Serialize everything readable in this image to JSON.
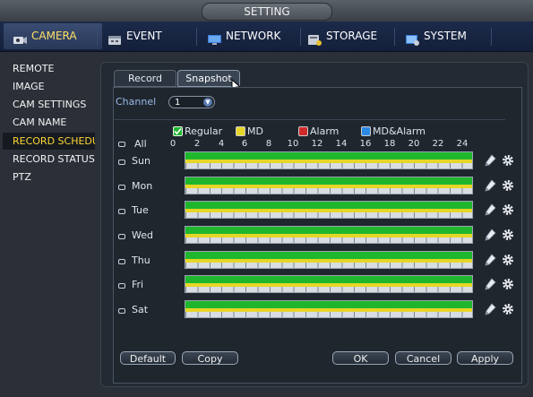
{
  "window": {
    "title": "SETTING"
  },
  "main_tabs": [
    {
      "label": "CAMERA",
      "icon": "camera-icon"
    },
    {
      "label": "EVENT",
      "icon": "event-icon"
    },
    {
      "label": "NETWORK",
      "icon": "network-icon"
    },
    {
      "label": "STORAGE",
      "icon": "storage-icon"
    },
    {
      "label": "SYSTEM",
      "icon": "system-icon"
    }
  ],
  "sidebar": {
    "items": [
      {
        "label": "REMOTE"
      },
      {
        "label": "IMAGE"
      },
      {
        "label": "CAM SETTINGS"
      },
      {
        "label": "CAM NAME"
      },
      {
        "label": "RECORD SCHEDULE"
      },
      {
        "label": "RECORD STATUS"
      },
      {
        "label": "PTZ"
      }
    ],
    "active_index": 4
  },
  "sub_tabs": [
    {
      "label": "Record"
    },
    {
      "label": "Snapshot"
    }
  ],
  "channel": {
    "label": "Channel",
    "value": "1"
  },
  "legend": [
    {
      "label": "Regular",
      "color": "#1fb62e",
      "checked": true
    },
    {
      "label": "MD",
      "color": "#e6d628"
    },
    {
      "label": "Alarm",
      "color": "#d22a2a"
    },
    {
      "label": "MD&Alarm",
      "color": "#2a8ae6"
    }
  ],
  "all_label": "All",
  "hours": [
    "0",
    "2",
    "4",
    "6",
    "8",
    "10",
    "12",
    "14",
    "16",
    "18",
    "20",
    "22",
    "24"
  ],
  "days": [
    "Sun",
    "Mon",
    "Tue",
    "Wed",
    "Thu",
    "Fri",
    "Sat"
  ],
  "buttons": {
    "default": "Default",
    "copy": "Copy",
    "ok": "OK",
    "cancel": "Cancel",
    "apply": "Apply"
  },
  "colors": {
    "active_text": "#ffd633",
    "regular": "#1fb62e",
    "md": "#e6d628"
  }
}
